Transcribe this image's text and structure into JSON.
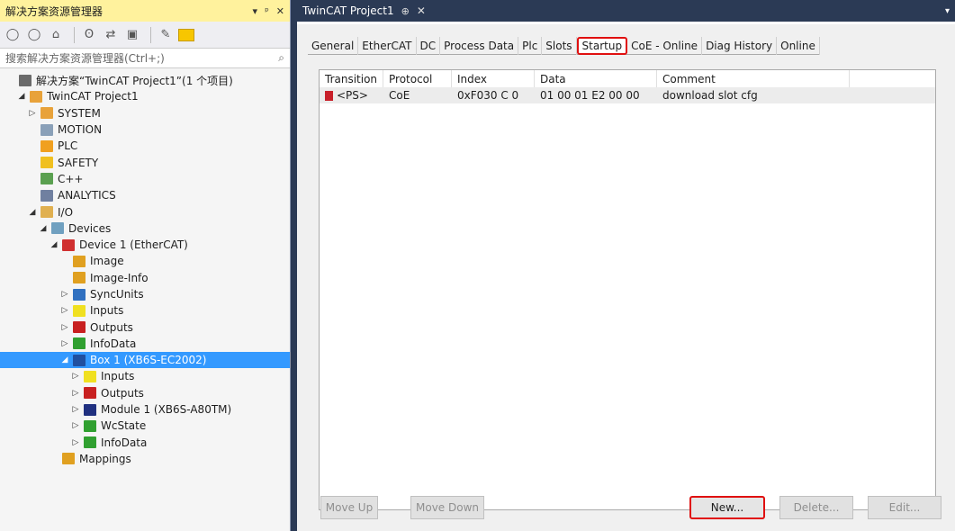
{
  "solution_explorer": {
    "title": "解决方案资源管理器",
    "title_controls": [
      "▾",
      "ᵖ",
      "✕"
    ],
    "search_placeholder": "搜索解决方案资源管理器(Ctrl+;)",
    "tree": [
      {
        "label": "解决方案“TwinCAT Project1”(1 个项目)",
        "icon": "solution-icon",
        "expanded": null,
        "depth": 0
      },
      {
        "label": "TwinCAT Project1",
        "icon": "project-icon",
        "expanded": true,
        "depth": 1
      },
      {
        "label": "SYSTEM",
        "icon": "system-icon",
        "expanded": false,
        "depth": 2
      },
      {
        "label": "MOTION",
        "icon": "motion-icon",
        "expanded": null,
        "depth": 2
      },
      {
        "label": "PLC",
        "icon": "plc-icon",
        "expanded": null,
        "depth": 2
      },
      {
        "label": "SAFETY",
        "icon": "safety-icon",
        "expanded": null,
        "depth": 2
      },
      {
        "label": "C++",
        "icon": "cpp-icon",
        "expanded": null,
        "depth": 2
      },
      {
        "label": "ANALYTICS",
        "icon": "analytics-icon",
        "expanded": null,
        "depth": 2
      },
      {
        "label": "I/O",
        "icon": "io-icon",
        "expanded": true,
        "depth": 2
      },
      {
        "label": "Devices",
        "icon": "devices-icon",
        "expanded": true,
        "depth": 3
      },
      {
        "label": "Device 1 (EtherCAT)",
        "icon": "ethercat-device-icon",
        "expanded": true,
        "depth": 4
      },
      {
        "label": "Image",
        "icon": "image-icon",
        "expanded": null,
        "depth": 5
      },
      {
        "label": "Image-Info",
        "icon": "image-info-icon",
        "expanded": null,
        "depth": 5
      },
      {
        "label": "SyncUnits",
        "icon": "syncunits-icon",
        "expanded": false,
        "depth": 5
      },
      {
        "label": "Inputs",
        "icon": "inputs-icon",
        "expanded": false,
        "depth": 5
      },
      {
        "label": "Outputs",
        "icon": "outputs-icon",
        "expanded": false,
        "depth": 5
      },
      {
        "label": "InfoData",
        "icon": "infodata-icon",
        "expanded": false,
        "depth": 5
      },
      {
        "label": "Box 1 (XB6S-EC2002)",
        "icon": "box-icon",
        "expanded": true,
        "depth": 5,
        "selected": true
      },
      {
        "label": "Inputs",
        "icon": "inputs-icon",
        "expanded": false,
        "depth": 6
      },
      {
        "label": "Outputs",
        "icon": "outputs-icon",
        "expanded": false,
        "depth": 6
      },
      {
        "label": "Module 1 (XB6S-A80TM)",
        "icon": "module-icon",
        "expanded": false,
        "depth": 6
      },
      {
        "label": "WcState",
        "icon": "wcstate-icon",
        "expanded": false,
        "depth": 6
      },
      {
        "label": "InfoData",
        "icon": "infodata-icon",
        "expanded": false,
        "depth": 6
      },
      {
        "label": "Mappings",
        "icon": "mappings-icon",
        "expanded": null,
        "depth": 4
      }
    ]
  },
  "document": {
    "tab_title": "TwinCAT Project1",
    "tab_pin": "⊕",
    "tab_close": "✕",
    "more": "▾",
    "tabs": [
      "General",
      "EtherCAT",
      "DC",
      "Process Data",
      "Plc",
      "Slots",
      "Startup",
      "CoE - Online",
      "Diag History",
      "Online"
    ],
    "active_tab": "Startup",
    "grid": {
      "columns": [
        "Transition",
        "Protocol",
        "Index",
        "Data",
        "Comment"
      ],
      "rows": [
        {
          "transition": "<PS>",
          "protocol": "CoE",
          "index": "0xF030 C 0",
          "data": "01 00 01 E2 00 00",
          "comment": "download slot cfg"
        }
      ]
    },
    "buttons": {
      "move_up": "Move Up",
      "move_down": "Move Down",
      "new": "New...",
      "delete": "Delete...",
      "edit": "Edit..."
    }
  }
}
